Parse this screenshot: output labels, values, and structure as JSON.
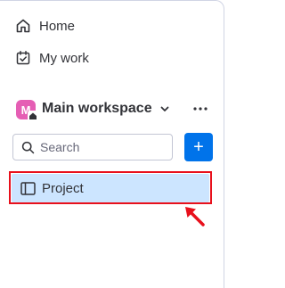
{
  "nav": {
    "home_label": "Home",
    "mywork_label": "My work"
  },
  "workspace": {
    "avatar_letter": "M",
    "name": "Main workspace",
    "avatar_color": "#e55eb4"
  },
  "search": {
    "placeholder": "Search"
  },
  "add_button": {
    "label": "+",
    "color": "#0073ea"
  },
  "boards": {
    "items": [
      {
        "label": "Project",
        "selected": true
      }
    ]
  },
  "annotation": {
    "highlight_color": "#e8101c"
  },
  "icons": {
    "home": "home-icon",
    "mywork": "calendar-check-icon",
    "chevron": "chevron-down-icon",
    "more": "more-dots-icon",
    "search": "search-icon",
    "board": "board-icon"
  }
}
